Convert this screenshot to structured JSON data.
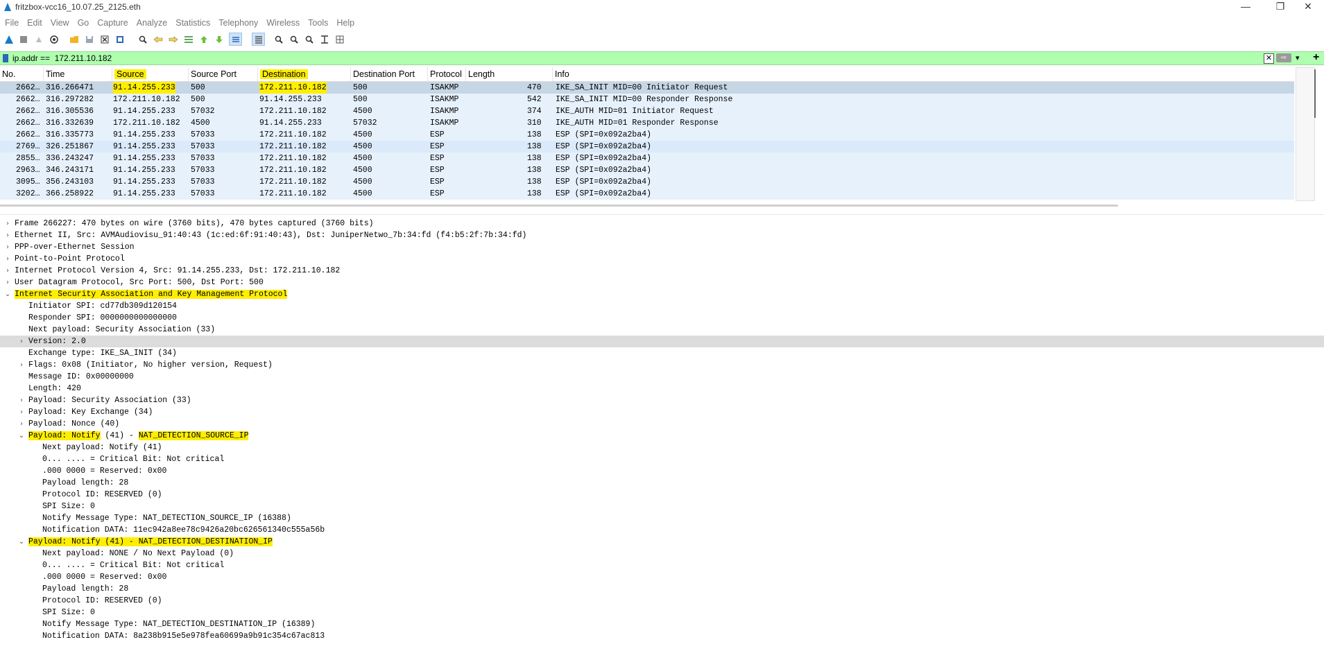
{
  "window": {
    "title": "fritzbox-vcc16_10.07.25_2125.eth",
    "min_glyph": "—",
    "max_glyph": "❐",
    "close_glyph": "✕"
  },
  "menu": [
    "File",
    "Edit",
    "View",
    "Go",
    "Capture",
    "Analyze",
    "Statistics",
    "Telephony",
    "Wireless",
    "Tools",
    "Help"
  ],
  "toolbar_icons": [
    "shark-fin-start-icon",
    "stop-icon",
    "restart-icon",
    "capture-options-icon",
    "open-file-icon",
    "save-file-icon",
    "close-file-icon",
    "reload-icon",
    "find-packet-icon",
    "go-back-icon",
    "go-forward-icon",
    "go-to-packet-icon",
    "go-first-icon",
    "go-last-icon",
    "autoscroll-icon",
    "colorize-icon",
    "zoom-in-icon",
    "zoom-out-icon",
    "zoom-normal-icon",
    "resize-columns-icon",
    "layout-icon"
  ],
  "filter": {
    "value": "ip.addr ==  172.211.10.182",
    "add_label": "+"
  },
  "packet_list": {
    "columns": [
      "No.",
      "Time",
      "Source",
      "Source Port",
      "Destination",
      "Destination Port",
      "Protocol",
      "Length",
      "Info"
    ],
    "rows": [
      [
        "2662…",
        "316.266471",
        "91.14.255.233",
        "500",
        "172.211.10.182",
        "500",
        "ISAKMP",
        "470",
        "IKE_SA_INIT MID=00 Initiator Request"
      ],
      [
        "2662…",
        "316.297282",
        "172.211.10.182",
        "500",
        "91.14.255.233",
        "500",
        "ISAKMP",
        "542",
        "IKE_SA_INIT MID=00 Responder Response"
      ],
      [
        "2662…",
        "316.305536",
        "91.14.255.233",
        "57032",
        "172.211.10.182",
        "4500",
        "ISAKMP",
        "374",
        "IKE_AUTH MID=01 Initiator Request"
      ],
      [
        "2662…",
        "316.332639",
        "172.211.10.182",
        "4500",
        "91.14.255.233",
        "57032",
        "ISAKMP",
        "310",
        "IKE_AUTH MID=01 Responder Response"
      ],
      [
        "2662…",
        "316.335773",
        "91.14.255.233",
        "57033",
        "172.211.10.182",
        "4500",
        "ESP",
        "138",
        "ESP (SPI=0x092a2ba4)"
      ],
      [
        "2769…",
        "326.251867",
        "91.14.255.233",
        "57033",
        "172.211.10.182",
        "4500",
        "ESP",
        "138",
        "ESP (SPI=0x092a2ba4)"
      ],
      [
        "2855…",
        "336.243247",
        "91.14.255.233",
        "57033",
        "172.211.10.182",
        "4500",
        "ESP",
        "138",
        "ESP (SPI=0x092a2ba4)"
      ],
      [
        "2963…",
        "346.243171",
        "91.14.255.233",
        "57033",
        "172.211.10.182",
        "4500",
        "ESP",
        "138",
        "ESP (SPI=0x092a2ba4)"
      ],
      [
        "3095…",
        "356.243103",
        "91.14.255.233",
        "57033",
        "172.211.10.182",
        "4500",
        "ESP",
        "138",
        "ESP (SPI=0x092a2ba4)"
      ],
      [
        "3202…",
        "366.258922",
        "91.14.255.233",
        "57033",
        "172.211.10.182",
        "4500",
        "ESP",
        "138",
        "ESP (SPI=0x092a2ba4)"
      ]
    ]
  },
  "details": [
    {
      "indent": 0,
      "arrow": "›",
      "text": "Frame 266227: 470 bytes on wire (3760 bits), 470 bytes captured (3760 bits)"
    },
    {
      "indent": 0,
      "arrow": "›",
      "text": "Ethernet II, Src: AVMAudiovisu_91:40:43 (1c:ed:6f:91:40:43), Dst: JuniperNetwo_7b:34:fd (f4:b5:2f:7b:34:fd)"
    },
    {
      "indent": 0,
      "arrow": "›",
      "text": "PPP-over-Ethernet Session"
    },
    {
      "indent": 0,
      "arrow": "›",
      "text": "Point-to-Point Protocol"
    },
    {
      "indent": 0,
      "arrow": "›",
      "text": "Internet Protocol Version 4, Src: 91.14.255.233, Dst: 172.211.10.182"
    },
    {
      "indent": 0,
      "arrow": "›",
      "text": "User Datagram Protocol, Src Port: 500, Dst Port: 500"
    },
    {
      "indent": 0,
      "arrow": "⌄",
      "text": "Internet Security Association and Key Management Protocol",
      "hl": "full"
    },
    {
      "indent": 1,
      "arrow": "",
      "text": "Initiator SPI: cd77db309d120154"
    },
    {
      "indent": 1,
      "arrow": "",
      "text": "Responder SPI: 0000000000000000"
    },
    {
      "indent": 1,
      "arrow": "",
      "text": "Next payload: Security Association (33)"
    },
    {
      "indent": 1,
      "arrow": "›",
      "text": "Version: 2.0",
      "grey": true
    },
    {
      "indent": 1,
      "arrow": "",
      "text": "Exchange type: IKE_SA_INIT (34)"
    },
    {
      "indent": 1,
      "arrow": "›",
      "text": "Flags: 0x08 (Initiator, No higher version, Request)"
    },
    {
      "indent": 1,
      "arrow": "",
      "text": "Message ID: 0x00000000"
    },
    {
      "indent": 1,
      "arrow": "",
      "text": "Length: 420"
    },
    {
      "indent": 1,
      "arrow": "›",
      "text": "Payload: Security Association (33)"
    },
    {
      "indent": 1,
      "arrow": "›",
      "text": "Payload: Key Exchange (34)"
    },
    {
      "indent": 1,
      "arrow": "›",
      "text": "Payload: Nonce (40)"
    },
    {
      "indent": 1,
      "arrow": "⌄",
      "text": "Payload: Notify (41) - NAT_DETECTION_SOURCE_IP",
      "hl": "notify"
    },
    {
      "indent": 2,
      "arrow": "",
      "text": "Next payload: Notify (41)"
    },
    {
      "indent": 2,
      "arrow": "",
      "text": "0... .... = Critical Bit: Not critical"
    },
    {
      "indent": 2,
      "arrow": "",
      "text": ".000 0000 = Reserved: 0x00"
    },
    {
      "indent": 2,
      "arrow": "",
      "text": "Payload length: 28"
    },
    {
      "indent": 2,
      "arrow": "",
      "text": "Protocol ID: RESERVED (0)"
    },
    {
      "indent": 2,
      "arrow": "",
      "text": "SPI Size: 0"
    },
    {
      "indent": 2,
      "arrow": "",
      "text": "Notify Message Type: NAT_DETECTION_SOURCE_IP (16388)"
    },
    {
      "indent": 2,
      "arrow": "",
      "text": "Notification DATA: 11ec942a8ee78c9426a20bc626561340c555a56b"
    },
    {
      "indent": 1,
      "arrow": "⌄",
      "text": "Payload: Notify (41) - NAT_DETECTION_DESTINATION_IP",
      "hl": "full"
    },
    {
      "indent": 2,
      "arrow": "",
      "text": "Next payload: NONE / No Next Payload (0)"
    },
    {
      "indent": 2,
      "arrow": "",
      "text": "0... .... = Critical Bit: Not critical"
    },
    {
      "indent": 2,
      "arrow": "",
      "text": ".000 0000 = Reserved: 0x00"
    },
    {
      "indent": 2,
      "arrow": "",
      "text": "Payload length: 28"
    },
    {
      "indent": 2,
      "arrow": "",
      "text": "Protocol ID: RESERVED (0)"
    },
    {
      "indent": 2,
      "arrow": "",
      "text": "SPI Size: 0"
    },
    {
      "indent": 2,
      "arrow": "",
      "text": "Notify Message Type: NAT_DETECTION_DESTINATION_IP (16389)"
    },
    {
      "indent": 2,
      "arrow": "",
      "text": "Notification DATA: 8a238b915e5e978fea60699a9b91c354c67ac813"
    }
  ],
  "colors": {
    "filter_bg": "#afffaf",
    "highlight": "#ffee00",
    "row_bg": "#e7f1fc",
    "selected_row_bg": "#c5d6e5"
  }
}
